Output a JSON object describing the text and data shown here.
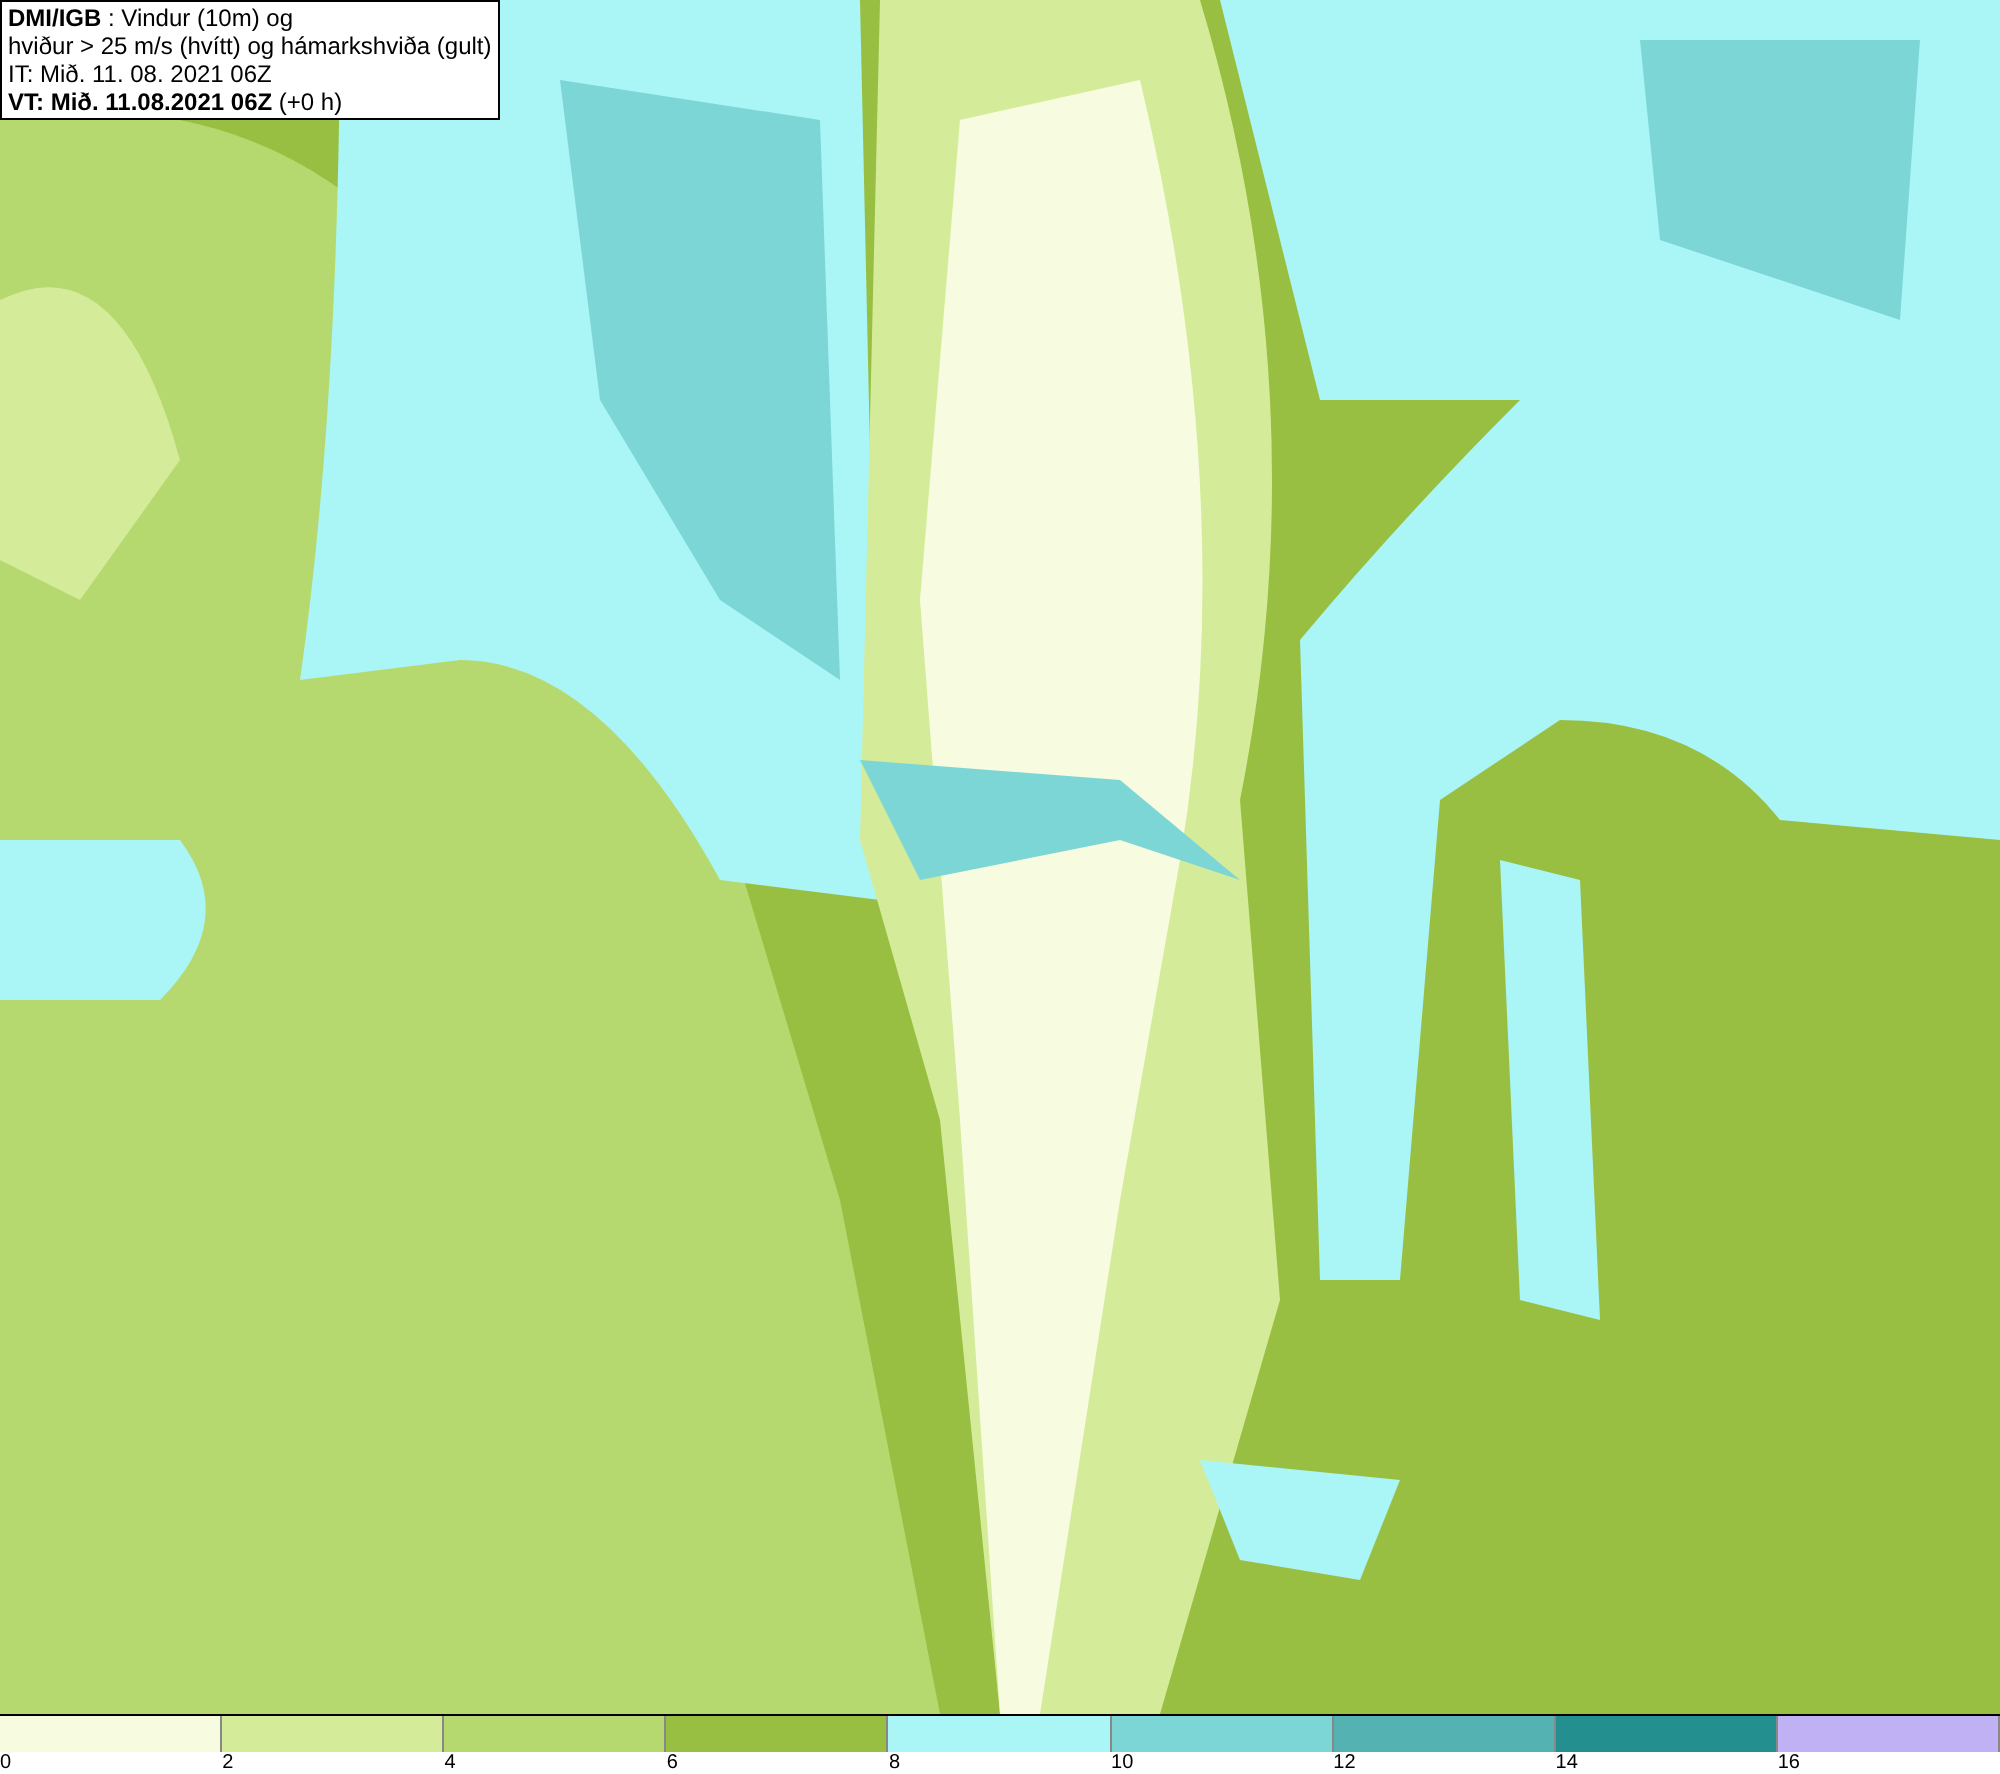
{
  "info_box": {
    "lines": [
      "**DMI/IGB** : Vindur (10m) og",
      "hviður > 25 m/s (hvítt) og hámarkshviða (gult)",
      "IT: Mið. 11. 08. 2021 06Z",
      "**VT: Mið. 11.08.2021 06Z** (+0 h)"
    ]
  },
  "legend": {
    "segments": [
      {
        "color": "#f7fce0",
        "label": "0"
      },
      {
        "color": "#d4ec9a",
        "label": "2"
      },
      {
        "color": "#b5d96e",
        "label": "4"
      },
      {
        "color": "#98bf42",
        "label": "6"
      },
      {
        "color": "#aaf6f6",
        "label": "8"
      },
      {
        "color": "#7dd6d6",
        "label": "10"
      },
      {
        "color": "#55b2b2",
        "label": "12"
      },
      {
        "color": "#238f8f",
        "label": "14"
      },
      {
        "color": "#c0b0f4",
        "label": "16"
      }
    ]
  }
}
